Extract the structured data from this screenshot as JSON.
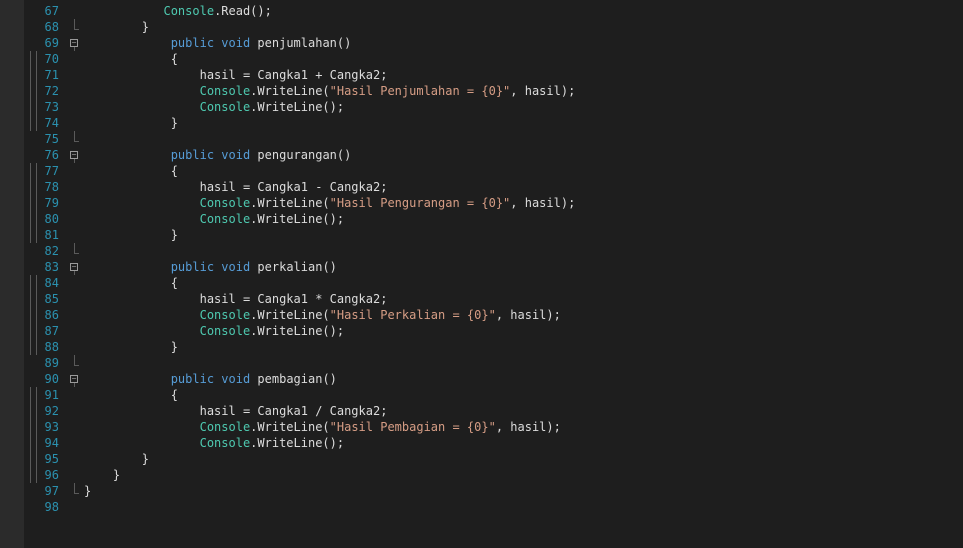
{
  "editor": {
    "lines": [
      {
        "n": "67",
        "fold": "",
        "indent": 11,
        "tokens": [
          {
            "t": "Console",
            "c": "cls"
          },
          {
            "t": ".Read();",
            "c": ""
          }
        ]
      },
      {
        "n": "68",
        "fold": "end",
        "indent": 8,
        "tokens": [
          {
            "t": "}",
            "c": ""
          }
        ]
      },
      {
        "n": "69",
        "fold": "start",
        "indent": 12,
        "tokens": [
          {
            "t": "public",
            "c": "kw"
          },
          {
            "t": " ",
            "c": ""
          },
          {
            "t": "void",
            "c": "kw"
          },
          {
            "t": " penjumlahan()",
            "c": ""
          }
        ]
      },
      {
        "n": "70",
        "fold": "line",
        "indent": 12,
        "tokens": [
          {
            "t": "{",
            "c": ""
          }
        ]
      },
      {
        "n": "71",
        "fold": "line",
        "indent": 16,
        "tokens": [
          {
            "t": "hasil = Cangka1 + Cangka2;",
            "c": ""
          }
        ]
      },
      {
        "n": "72",
        "fold": "line",
        "indent": 16,
        "tokens": [
          {
            "t": "Console",
            "c": "cls"
          },
          {
            "t": ".WriteLine(",
            "c": ""
          },
          {
            "t": "\"Hasil Penjumlahan = {0}\"",
            "c": "str"
          },
          {
            "t": ", hasil);",
            "c": ""
          }
        ]
      },
      {
        "n": "73",
        "fold": "line",
        "indent": 16,
        "tokens": [
          {
            "t": "Console",
            "c": "cls"
          },
          {
            "t": ".WriteLine();",
            "c": ""
          }
        ]
      },
      {
        "n": "74",
        "fold": "line",
        "indent": 12,
        "tokens": [
          {
            "t": "}",
            "c": ""
          }
        ]
      },
      {
        "n": "75",
        "fold": "end",
        "indent": 0,
        "tokens": []
      },
      {
        "n": "76",
        "fold": "start",
        "indent": 12,
        "tokens": [
          {
            "t": "public",
            "c": "kw"
          },
          {
            "t": " ",
            "c": ""
          },
          {
            "t": "void",
            "c": "kw"
          },
          {
            "t": " pengurangan()",
            "c": ""
          }
        ]
      },
      {
        "n": "77",
        "fold": "line",
        "indent": 12,
        "tokens": [
          {
            "t": "{",
            "c": ""
          }
        ]
      },
      {
        "n": "78",
        "fold": "line",
        "indent": 16,
        "tokens": [
          {
            "t": "hasil = Cangka1 - Cangka2;",
            "c": ""
          }
        ]
      },
      {
        "n": "79",
        "fold": "line",
        "indent": 16,
        "tokens": [
          {
            "t": "Console",
            "c": "cls"
          },
          {
            "t": ".WriteLine(",
            "c": ""
          },
          {
            "t": "\"Hasil Pengurangan = {0}\"",
            "c": "str"
          },
          {
            "t": ", hasil);",
            "c": ""
          }
        ]
      },
      {
        "n": "80",
        "fold": "line",
        "indent": 16,
        "tokens": [
          {
            "t": "Console",
            "c": "cls"
          },
          {
            "t": ".WriteLine();",
            "c": ""
          }
        ]
      },
      {
        "n": "81",
        "fold": "line",
        "indent": 12,
        "tokens": [
          {
            "t": "}",
            "c": ""
          }
        ]
      },
      {
        "n": "82",
        "fold": "end",
        "indent": 0,
        "tokens": []
      },
      {
        "n": "83",
        "fold": "start",
        "indent": 12,
        "tokens": [
          {
            "t": "public",
            "c": "kw"
          },
          {
            "t": " ",
            "c": ""
          },
          {
            "t": "void",
            "c": "kw"
          },
          {
            "t": " perkalian()",
            "c": ""
          }
        ]
      },
      {
        "n": "84",
        "fold": "line",
        "indent": 12,
        "tokens": [
          {
            "t": "{",
            "c": ""
          }
        ]
      },
      {
        "n": "85",
        "fold": "line",
        "indent": 16,
        "tokens": [
          {
            "t": "hasil = Cangka1 * Cangka2;",
            "c": ""
          }
        ]
      },
      {
        "n": "86",
        "fold": "line",
        "indent": 16,
        "tokens": [
          {
            "t": "Console",
            "c": "cls"
          },
          {
            "t": ".WriteLine(",
            "c": ""
          },
          {
            "t": "\"Hasil Perkalian = {0}\"",
            "c": "str"
          },
          {
            "t": ", hasil);",
            "c": ""
          }
        ]
      },
      {
        "n": "87",
        "fold": "line",
        "indent": 16,
        "tokens": [
          {
            "t": "Console",
            "c": "cls"
          },
          {
            "t": ".WriteLine();",
            "c": ""
          }
        ]
      },
      {
        "n": "88",
        "fold": "line",
        "indent": 12,
        "tokens": [
          {
            "t": "}",
            "c": ""
          }
        ]
      },
      {
        "n": "89",
        "fold": "end",
        "indent": 0,
        "tokens": []
      },
      {
        "n": "90",
        "fold": "start",
        "indent": 12,
        "tokens": [
          {
            "t": "public",
            "c": "kw"
          },
          {
            "t": " ",
            "c": ""
          },
          {
            "t": "void",
            "c": "kw"
          },
          {
            "t": " pembagian()",
            "c": ""
          }
        ]
      },
      {
        "n": "91",
        "fold": "line",
        "indent": 12,
        "tokens": [
          {
            "t": "{",
            "c": ""
          }
        ]
      },
      {
        "n": "92",
        "fold": "line",
        "indent": 16,
        "tokens": [
          {
            "t": "hasil = Cangka1 / Cangka2;",
            "c": ""
          }
        ]
      },
      {
        "n": "93",
        "fold": "line",
        "indent": 16,
        "tokens": [
          {
            "t": "Console",
            "c": "cls"
          },
          {
            "t": ".WriteLine(",
            "c": ""
          },
          {
            "t": "\"Hasil Pembagian = {0}\"",
            "c": "str"
          },
          {
            "t": ", hasil);",
            "c": ""
          }
        ]
      },
      {
        "n": "94",
        "fold": "line",
        "indent": 16,
        "tokens": [
          {
            "t": "Console",
            "c": "cls"
          },
          {
            "t": ".WriteLine();",
            "c": ""
          }
        ]
      },
      {
        "n": "95",
        "fold": "line",
        "indent": 8,
        "tokens": [
          {
            "t": "}",
            "c": ""
          }
        ]
      },
      {
        "n": "96",
        "fold": "line",
        "indent": 4,
        "tokens": [
          {
            "t": "}",
            "c": ""
          }
        ]
      },
      {
        "n": "97",
        "fold": "end",
        "indent": 0,
        "tokens": [
          {
            "t": "}",
            "c": ""
          }
        ]
      },
      {
        "n": "98",
        "fold": "",
        "indent": 0,
        "tokens": []
      }
    ]
  },
  "colors": {
    "background": "#1e1e1e",
    "line_number": "#2b91af",
    "keyword": "#569cd6",
    "class": "#4ec9b0",
    "string": "#d69d85",
    "text": "#dcdcdc"
  },
  "icons": {
    "fold": "collapse-toggle-icon"
  }
}
